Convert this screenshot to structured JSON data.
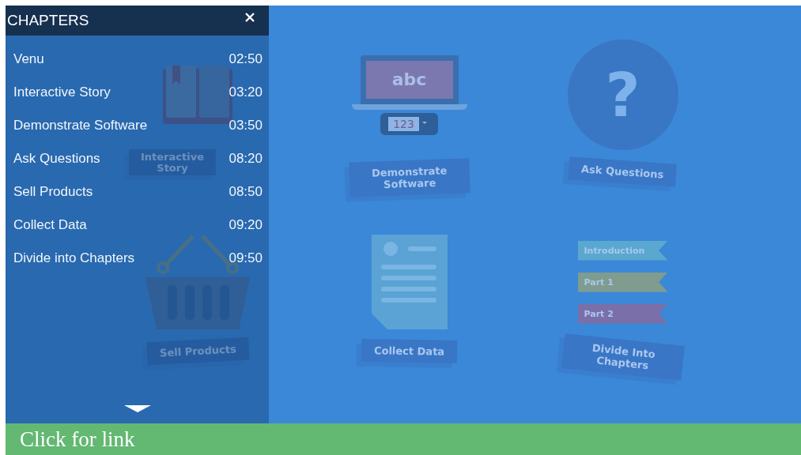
{
  "sidebar": {
    "title": "CHAPTERS",
    "items": [
      {
        "label": "Venu",
        "time": "02:50"
      },
      {
        "label": "Interactive Story",
        "time": "03:20"
      },
      {
        "label": "Demonstrate Software",
        "time": "03:50"
      },
      {
        "label": "Ask Questions",
        "time": "08:20"
      },
      {
        "label": "Sell Products",
        "time": "08:50"
      },
      {
        "label": "Collect Data",
        "time": "09:20"
      },
      {
        "label": "Divide into Chapters",
        "time": "09:50"
      }
    ]
  },
  "tiles": [
    {
      "kind": "book",
      "label": "Interactive Story"
    },
    {
      "kind": "laptop",
      "label": "Demonstrate Software",
      "screen_text": "abc",
      "field_text": "123"
    },
    {
      "kind": "question",
      "label": "Ask Questions",
      "glyph": "?"
    },
    {
      "kind": "basket",
      "label": "Sell Products"
    },
    {
      "kind": "form",
      "label": "Collect Data"
    },
    {
      "kind": "ribbons",
      "label": "Divide Into Chapters",
      "ribbons": [
        {
          "text": "Introduction",
          "color": "#5aa8cf"
        },
        {
          "text": "Part 1",
          "color": "#7f9c8e"
        },
        {
          "text": "Part 2",
          "color": "#7a6fa8"
        }
      ]
    }
  ],
  "link_bar": {
    "text": "Click for link"
  }
}
